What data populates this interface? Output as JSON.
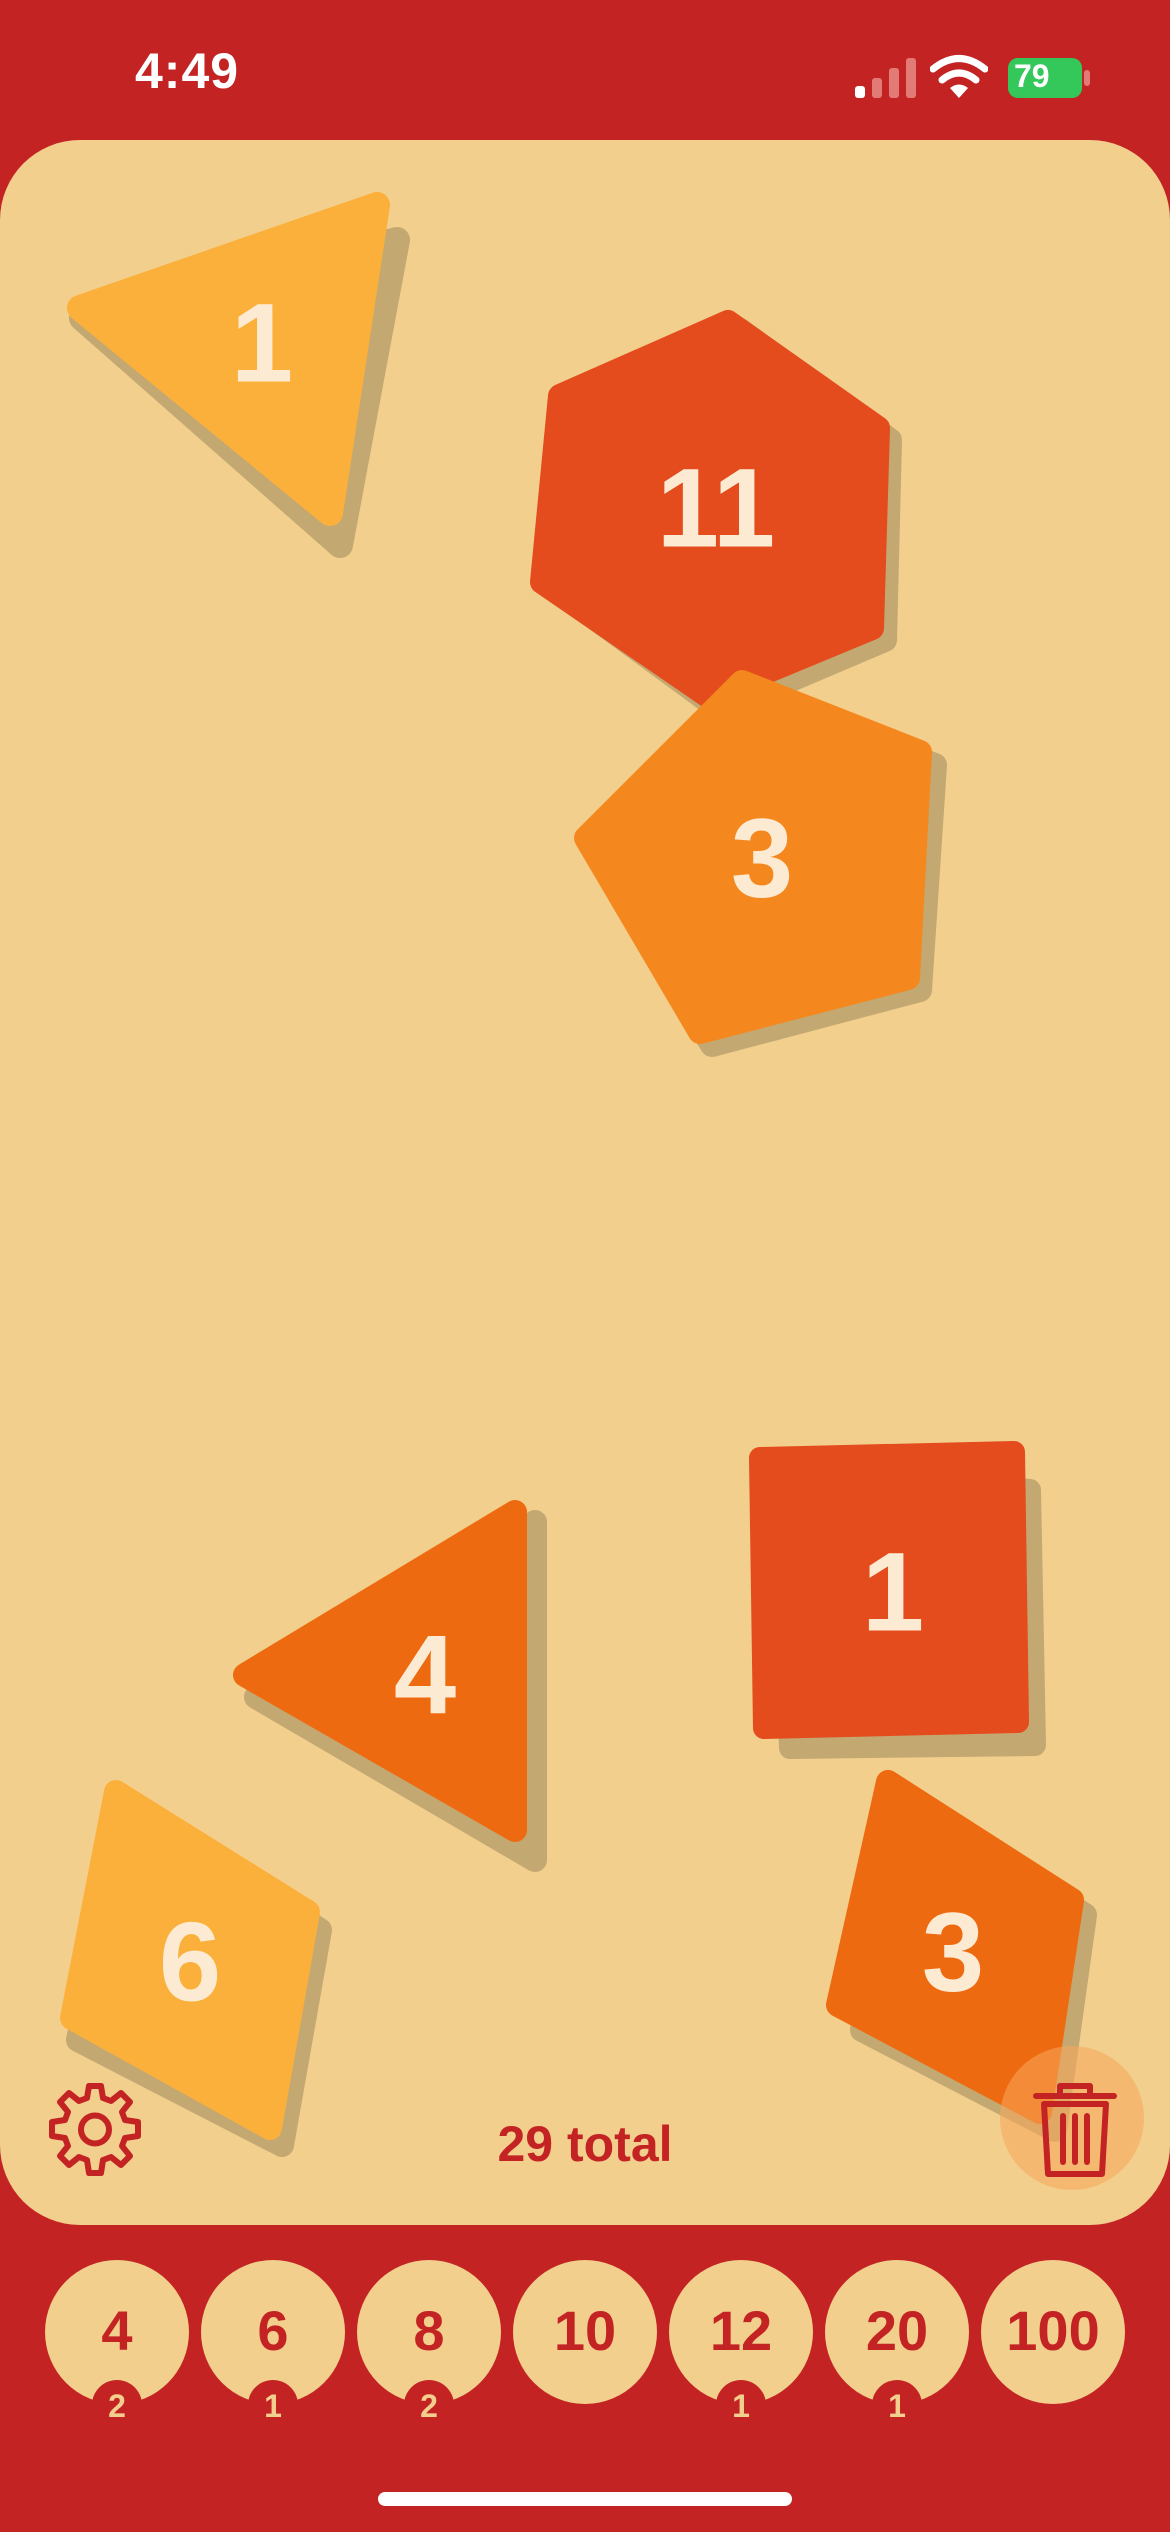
{
  "status": {
    "time": "4:49",
    "battery": "79"
  },
  "dice": [
    {
      "value": "1"
    },
    {
      "value": "11"
    },
    {
      "value": "3"
    },
    {
      "value": "1"
    },
    {
      "value": "4"
    },
    {
      "value": "6"
    },
    {
      "value": "3"
    }
  ],
  "footer": {
    "total": "29 total"
  },
  "picker": [
    {
      "label": "4",
      "count": "2"
    },
    {
      "label": "6",
      "count": "1"
    },
    {
      "label": "8",
      "count": "2"
    },
    {
      "label": "10",
      "count": ""
    },
    {
      "label": "12",
      "count": "1"
    },
    {
      "label": "20",
      "count": "1"
    },
    {
      "label": "100",
      "count": ""
    }
  ],
  "colors": {
    "background": "#C42324",
    "board": "#F2CF8D",
    "shadow": "#C4A872",
    "yellow": "#FBB03B",
    "orange": "#F5871F",
    "dark_orange": "#EE6A10",
    "red_orange": "#E44B1D",
    "label": "#FCEBD2"
  }
}
